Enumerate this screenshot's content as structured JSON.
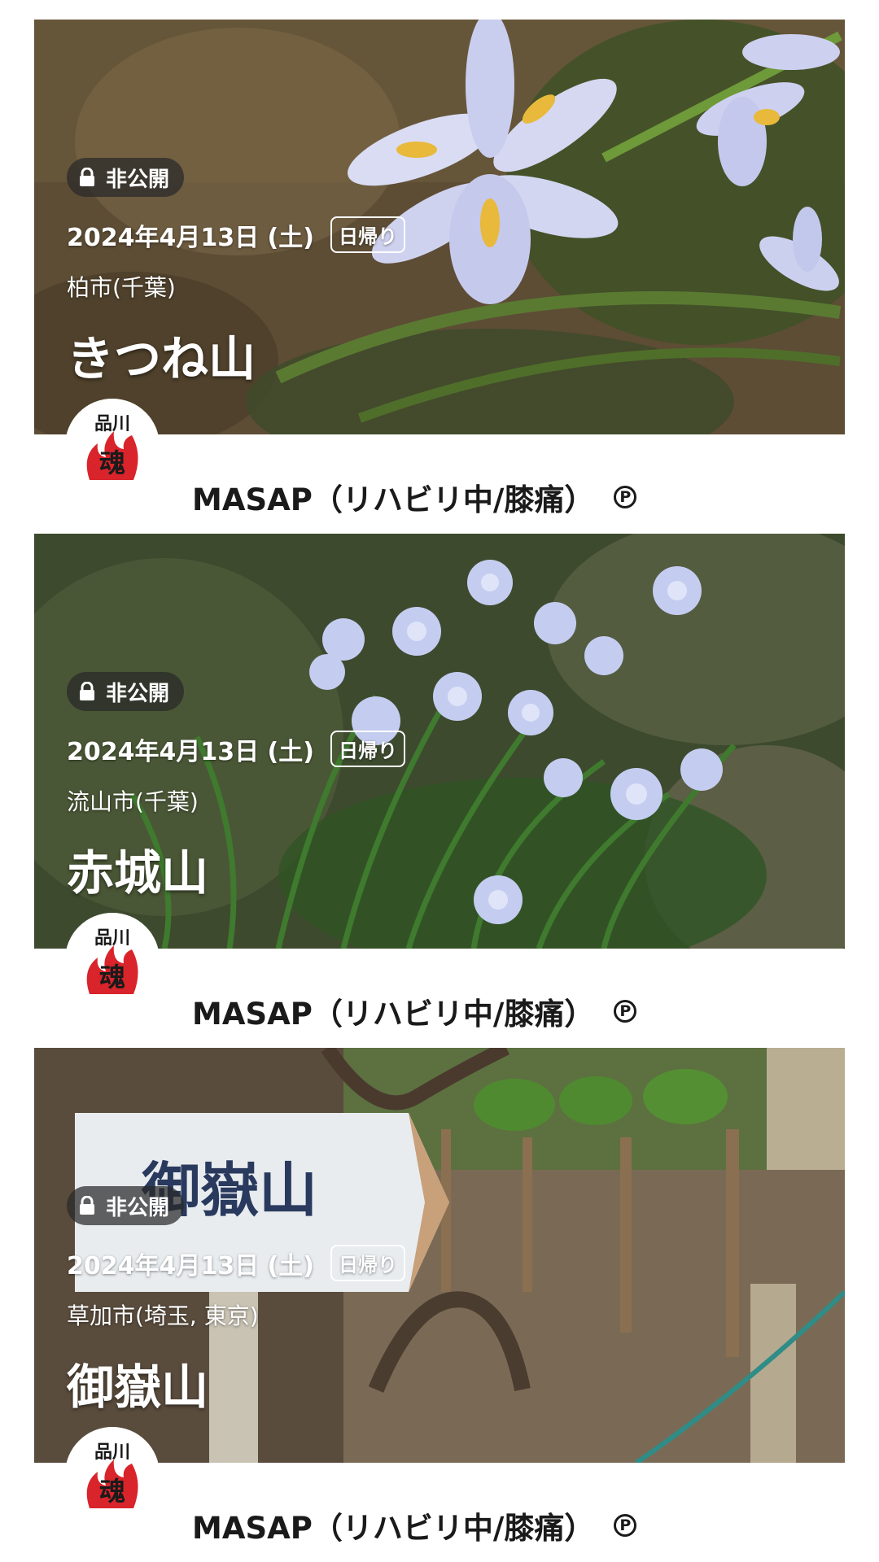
{
  "posts": [
    {
      "privacy_label": "非公開",
      "date": "2024年4月13日 (土)",
      "trip_type": "日帰り",
      "location": "柏市(千葉)",
      "mountain": "きつね山",
      "user": {
        "name": "MASAP（リハビリ中/膝痛）",
        "badge": "P"
      }
    },
    {
      "privacy_label": "非公開",
      "date": "2024年4月13日 (土)",
      "trip_type": "日帰り",
      "location": "流山市(千葉)",
      "mountain": "赤城山",
      "user": {
        "name": "MASAP（リハビリ中/膝痛）",
        "badge": "P"
      }
    },
    {
      "privacy_label": "非公開",
      "date": "2024年4月13日 (土)",
      "trip_type": "日帰り",
      "location": "草加市(埼玉, 東京)",
      "mountain": "御嶽山",
      "user": {
        "name": "MASAP（リハビリ中/膝痛）",
        "badge": "P"
      }
    }
  ],
  "icons": {
    "lock": "lock-icon",
    "premium": "premium-p-icon",
    "avatar": "flame-logo-avatar"
  },
  "colors": {
    "badge_bg": "#282828",
    "text_dark": "#1a1a1a"
  }
}
